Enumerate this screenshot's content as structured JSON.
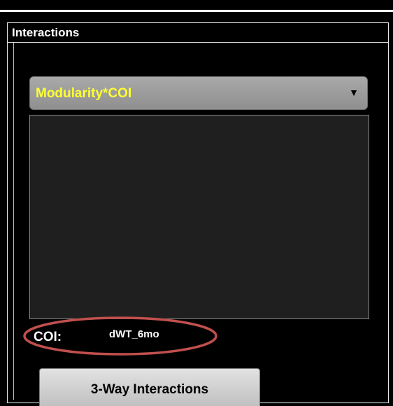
{
  "panel": {
    "title": "Interactions"
  },
  "interaction_select": {
    "selected_value": "Modularity*COI",
    "value_color": "#ffff33"
  },
  "coi": {
    "label": "COI:",
    "value": "dWT_6mo",
    "highlight_color": "#c0504d"
  },
  "actions": {
    "three_way_label": "3-Way Interactions"
  },
  "icons": {
    "dropdown": "chevron-down-icon"
  }
}
